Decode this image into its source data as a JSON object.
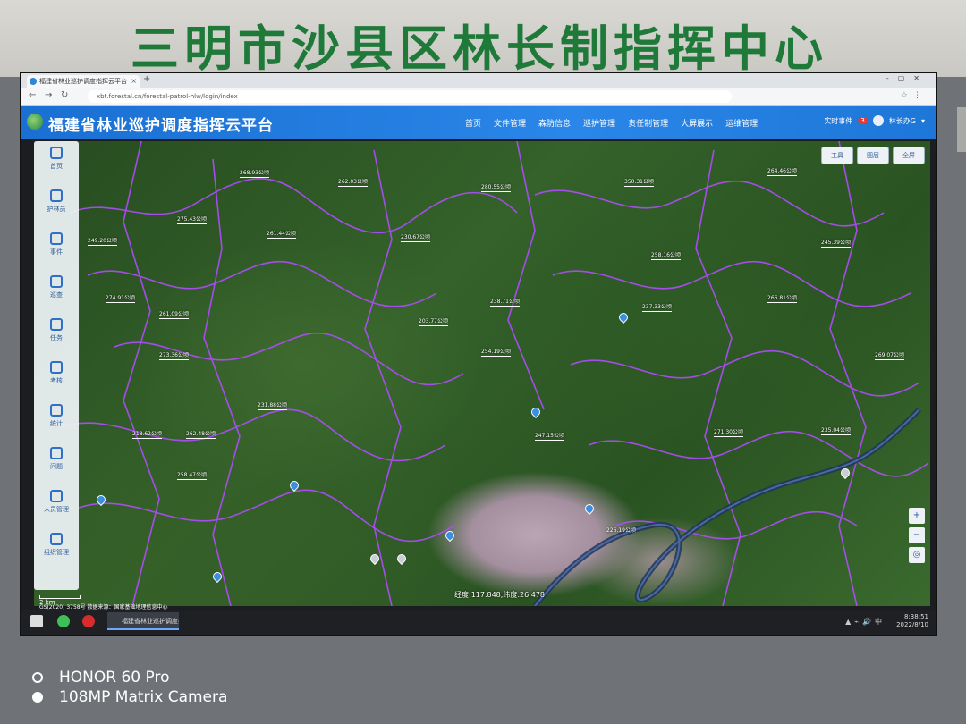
{
  "sign": {
    "text": "三明市沙县区林长制指挥中心"
  },
  "browser": {
    "tab_title": "福建省林业巡护调度指挥云平台",
    "url": "xbt.forestal.cn/forestal-patrol-hlw/login/index"
  },
  "app": {
    "title": "福建省林业巡护调度指挥云平台",
    "nav": [
      "首页",
      "文件管理",
      "森防信息",
      "巡护管理",
      "责任制管理",
      "大屏展示",
      "运维管理"
    ],
    "header_right": {
      "realtime": "实时事件",
      "badge": "3",
      "user": "林长办G"
    }
  },
  "sidebar": {
    "items": [
      {
        "label": "首页"
      },
      {
        "label": "护林员"
      },
      {
        "label": "事件"
      },
      {
        "label": "巡查"
      },
      {
        "label": "任务"
      },
      {
        "label": "考核"
      },
      {
        "label": "统计"
      },
      {
        "label": "问题"
      },
      {
        "label": "人员管理"
      },
      {
        "label": "组织管理"
      }
    ]
  },
  "map": {
    "tools": [
      "工具",
      "图层",
      "全屏"
    ],
    "scale": "2 km",
    "copyright": "GS(2020) 3758号  数据来源：国家基础地理信息中心",
    "coords": "经度:117.848,纬度:26.478",
    "labels": [
      "268.93公顷",
      "262.03公顷",
      "280.55公顷",
      "350.31公顷",
      "264.46公顷",
      "275.43公顷",
      "249.20公顷",
      "261.44公顷",
      "230.67公顷",
      "245.39公顷",
      "258.16公顷",
      "274.91公顷",
      "261.09公顷",
      "238.71公顷",
      "266.81公顷",
      "237.33公顷",
      "273.36公顷",
      "203.77公顷",
      "254.19公顷",
      "269.07公顷",
      "231.88公顷",
      "218.62公顷",
      "262.48公顷",
      "247.15公顷",
      "271.30公顷",
      "235.04公顷",
      "258.47公顷",
      "226.19公顷"
    ]
  },
  "taskbar": {
    "task": "福建省林业巡护调度指挥云平台",
    "time": "8:38:51",
    "date": "2022/8/10",
    "lang": "中"
  },
  "watermark": {
    "line1": "HONOR 60 Pro",
    "line2": "108MP Matrix Camera"
  }
}
